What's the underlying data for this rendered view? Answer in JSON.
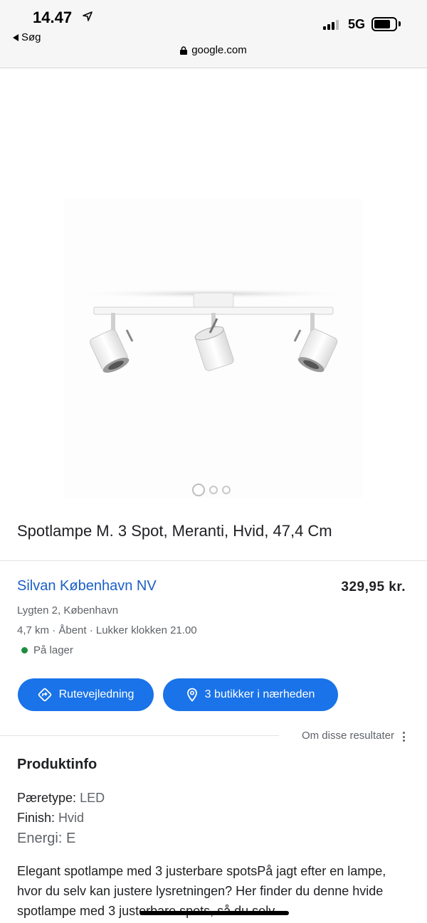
{
  "status_bar": {
    "time": "14.47",
    "back_label": "Søg",
    "network": "5G",
    "url": "google.com"
  },
  "product": {
    "title": "Spotlampe M. 3 Spot, Meranti, Hvid, 47,4 Cm",
    "image_count": 3,
    "active_image_index": 0
  },
  "store": {
    "name": "Silvan København NV",
    "price": "329,95 kr.",
    "address": "Lygten 2, København",
    "distance_hours": "4,7 km · Åbent · Lukker klokken 21.00",
    "stock": "På lager",
    "stock_color": "#1e8e3e"
  },
  "actions": {
    "directions": "Rutevejledning",
    "nearby": "3 butikker i nærheden"
  },
  "about_results": "Om disse resultater",
  "product_info": {
    "title": "Produktinfo",
    "bulb_label": "Pæretype:",
    "bulb_value": "LED",
    "finish_label": "Finish:",
    "finish_value": "Hvid",
    "energy_label": "Energi:",
    "energy_value": "E",
    "description": "Elegant spotlampe med 3 justerbare spotsPå jagt efter en lampe, hvor du selv kan justere lysretningen? Her finder du denne hvide spotlampe med 3 justerbare spots, så du selv"
  },
  "colors": {
    "accent": "#1a73e8",
    "link": "#1a5fc7"
  }
}
